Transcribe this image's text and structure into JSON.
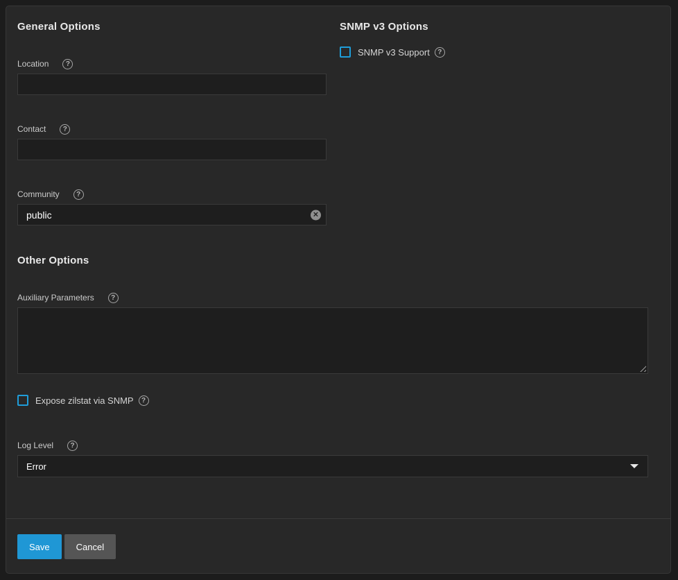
{
  "general": {
    "title": "General Options",
    "fields": [
      {
        "label": "Location",
        "value": ""
      },
      {
        "label": "Contact",
        "value": ""
      },
      {
        "label": "Community",
        "value": "public"
      }
    ]
  },
  "snmp_v3": {
    "title": "SNMP v3 Options",
    "checkbox_label": "SNMP v3 Support",
    "checked": false
  },
  "other": {
    "title": "Other Options",
    "aux_label": "Auxiliary Parameters",
    "aux_value": "",
    "expose_label": "Expose zilstat via SNMP",
    "expose_checked": false,
    "log_level_label": "Log Level",
    "log_level_value": "Error"
  },
  "actions": {
    "save": "Save",
    "cancel": "Cancel"
  },
  "icons": {
    "help": "?",
    "clear": "✕"
  },
  "colors": {
    "accent_blue": "#1f9dd9",
    "save_button": "#1f97d5",
    "cancel_button": "#555555",
    "card_background": "#282828",
    "page_background": "#1c1c1c",
    "input_background": "#1e1e1e"
  }
}
